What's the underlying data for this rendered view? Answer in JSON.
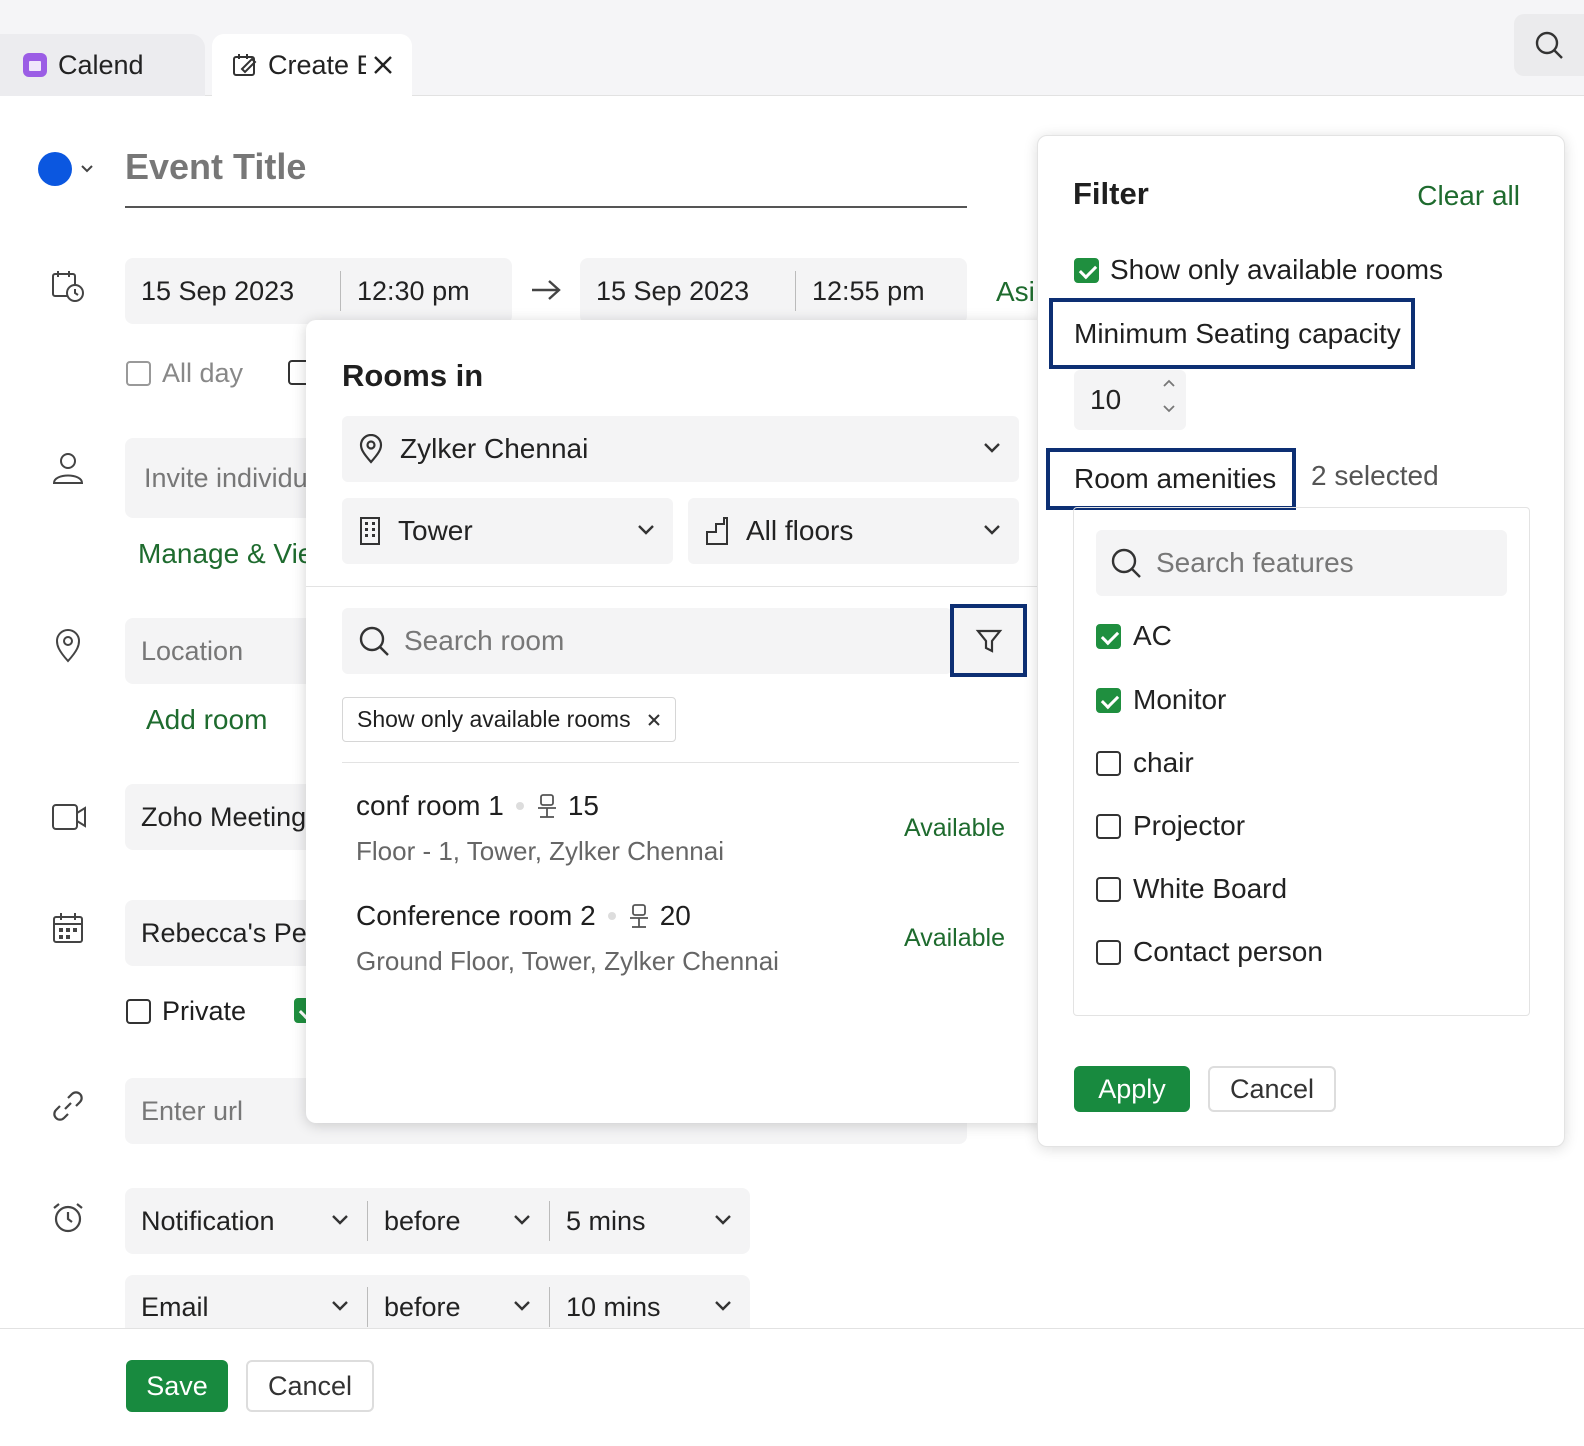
{
  "tabs": {
    "calendar_label": "Calend",
    "create_label": "Create E"
  },
  "form": {
    "title_placeholder": "Event Title",
    "start_date": "15 Sep 2023",
    "start_time": "12:30 pm",
    "end_date": "15 Sep 2023",
    "end_time": "12:55 pm",
    "timezone_partial": "Asi",
    "all_day_label": "All day",
    "invite_placeholder": "Invite individu",
    "manage_link": "Manage & Vie",
    "location_placeholder": "Location",
    "add_room_link": "Add room",
    "meeting_provider": "Zoho Meeting",
    "calendar_name": "Rebecca's Per",
    "private_label": "Private",
    "url_placeholder": "Enter url",
    "reminders": [
      {
        "type": "Notification",
        "when": "before",
        "amount": "5 mins"
      },
      {
        "type": "Email",
        "when": "before",
        "amount": "10 mins"
      }
    ],
    "save_label": "Save",
    "cancel_label": "Cancel"
  },
  "rooms": {
    "heading": "Rooms in",
    "location": "Zylker Chennai",
    "building": "Tower",
    "floor": "All floors",
    "search_placeholder": "Search room",
    "chip_label": "Show only available rooms",
    "list": [
      {
        "name": "conf room 1",
        "capacity": "15",
        "address": "Floor - 1, Tower, Zylker Chennai",
        "status": "Available"
      },
      {
        "name": "Conference room 2",
        "capacity": "20",
        "address": "Ground Floor, Tower, Zylker Chennai",
        "status": "Available"
      }
    ]
  },
  "filter": {
    "heading": "Filter",
    "clear_all": "Clear all",
    "available_only_label": "Show only available rooms",
    "available_only_checked": true,
    "seating_label": "Minimum Seating capacity",
    "seating_value": "10",
    "amenities_label": "Room amenities",
    "amenities_count": "2 selected",
    "search_placeholder": "Search features",
    "amenities": [
      {
        "label": "AC",
        "checked": true
      },
      {
        "label": "Monitor",
        "checked": true
      },
      {
        "label": "chair",
        "checked": false
      },
      {
        "label": "Projector",
        "checked": false
      },
      {
        "label": "White Board",
        "checked": false
      },
      {
        "label": "Contact person",
        "checked": false
      }
    ],
    "apply_label": "Apply",
    "cancel_label": "Cancel"
  },
  "colors": {
    "event_color": "#0b57e0",
    "brand_green": "#188a3f",
    "link_green": "#1e6b2e",
    "highlight_border": "#0d2f73"
  }
}
